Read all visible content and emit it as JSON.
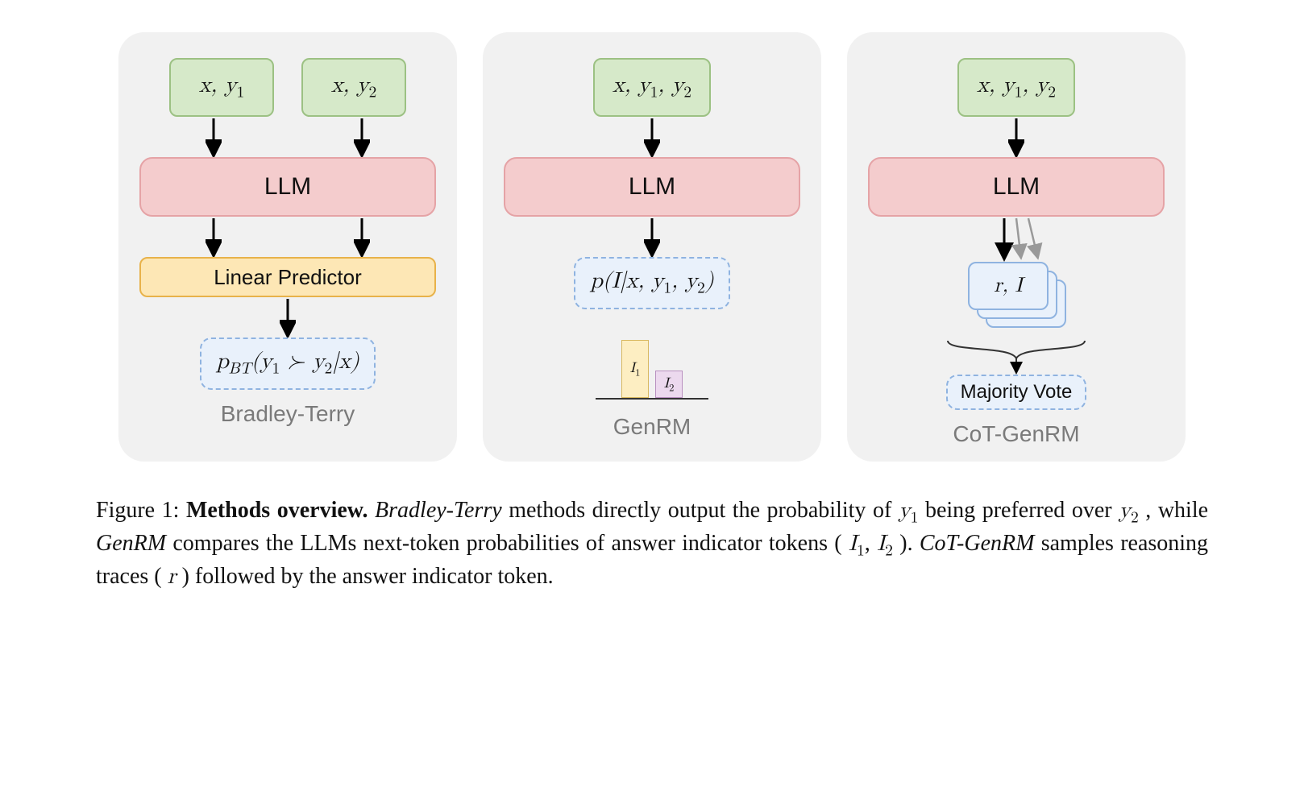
{
  "panels": {
    "bradley_terry": {
      "input_left": "x, y₁",
      "input_right": "x, y₂",
      "llm": "LLM",
      "linear": "Linear Predictor",
      "prob": "p_BT(y₁ ≻ y₂ | x)",
      "label": "Bradley-Terry"
    },
    "genrm": {
      "input": "x, y₁, y₂",
      "llm": "LLM",
      "prob": "p(I | x, y₁, y₂)",
      "bar1": "I₁",
      "bar2": "I₂",
      "label": "GenRM"
    },
    "cot": {
      "input": "x, y₁, y₂",
      "llm": "LLM",
      "sample": "r, I",
      "vote": "Majority Vote",
      "label": "CoT-GenRM"
    }
  },
  "caption": {
    "fig_number": "Figure 1:",
    "title": "Methods overview.",
    "body_a": "Bradley-Terry",
    "body_b": " methods directly output the probability of ",
    "body_c": " being preferred over ",
    "body_d": ", while ",
    "body_e": "GenRM",
    "body_f": " compares the LLMs next-token probabilities of answer indicator tokens (",
    "body_g": "). ",
    "body_h": "CoT-GenRM",
    "body_i": " samples reasoning traces (",
    "body_j": ") followed by the answer indicator token.",
    "y1": "y₁",
    "y2": "y₂",
    "I1": "I₁",
    "I2": "I₂",
    "r": "r"
  }
}
